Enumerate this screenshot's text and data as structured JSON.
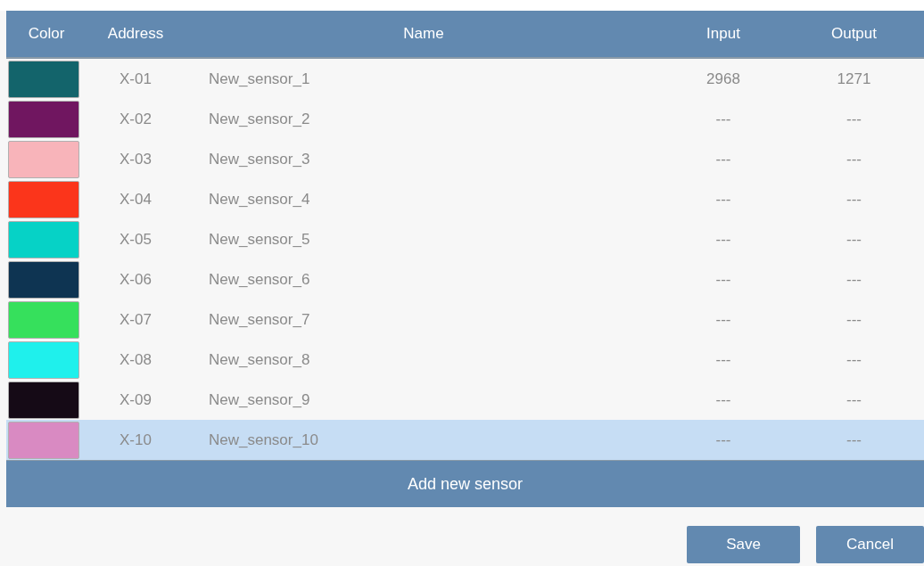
{
  "table": {
    "columns": [
      "Color",
      "Address",
      "Name",
      "Input",
      "Output"
    ],
    "rows": [
      {
        "color": "#13646b",
        "address": "X-01",
        "name": "New_sensor_1",
        "input": "2968",
        "output": "1271",
        "selected": false
      },
      {
        "color": "#701660",
        "address": "X-02",
        "name": "New_sensor_2",
        "input": "---",
        "output": "---",
        "selected": false
      },
      {
        "color": "#f8b4ba",
        "address": "X-03",
        "name": "New_sensor_3",
        "input": "---",
        "output": "---",
        "selected": false
      },
      {
        "color": "#fb351b",
        "address": "X-04",
        "name": "New_sensor_4",
        "input": "---",
        "output": "---",
        "selected": false
      },
      {
        "color": "#06d2c6",
        "address": "X-05",
        "name": "New_sensor_5",
        "input": "---",
        "output": "---",
        "selected": false
      },
      {
        "color": "#0e3452",
        "address": "X-06",
        "name": "New_sensor_6",
        "input": "---",
        "output": "---",
        "selected": false
      },
      {
        "color": "#36e05c",
        "address": "X-07",
        "name": "New_sensor_7",
        "input": "---",
        "output": "---",
        "selected": false
      },
      {
        "color": "#1ff0ec",
        "address": "X-08",
        "name": "New_sensor_8",
        "input": "---",
        "output": "---",
        "selected": false
      },
      {
        "color": "#150a16",
        "address": "X-09",
        "name": "New_sensor_9",
        "input": "---",
        "output": "---",
        "selected": false
      },
      {
        "color": "#d98ac2",
        "address": "X-10",
        "name": "New_sensor_10",
        "input": "---",
        "output": "---",
        "selected": true
      }
    ]
  },
  "add_button": "Add new sensor",
  "buttons": [
    "Save",
    "Cancel"
  ]
}
